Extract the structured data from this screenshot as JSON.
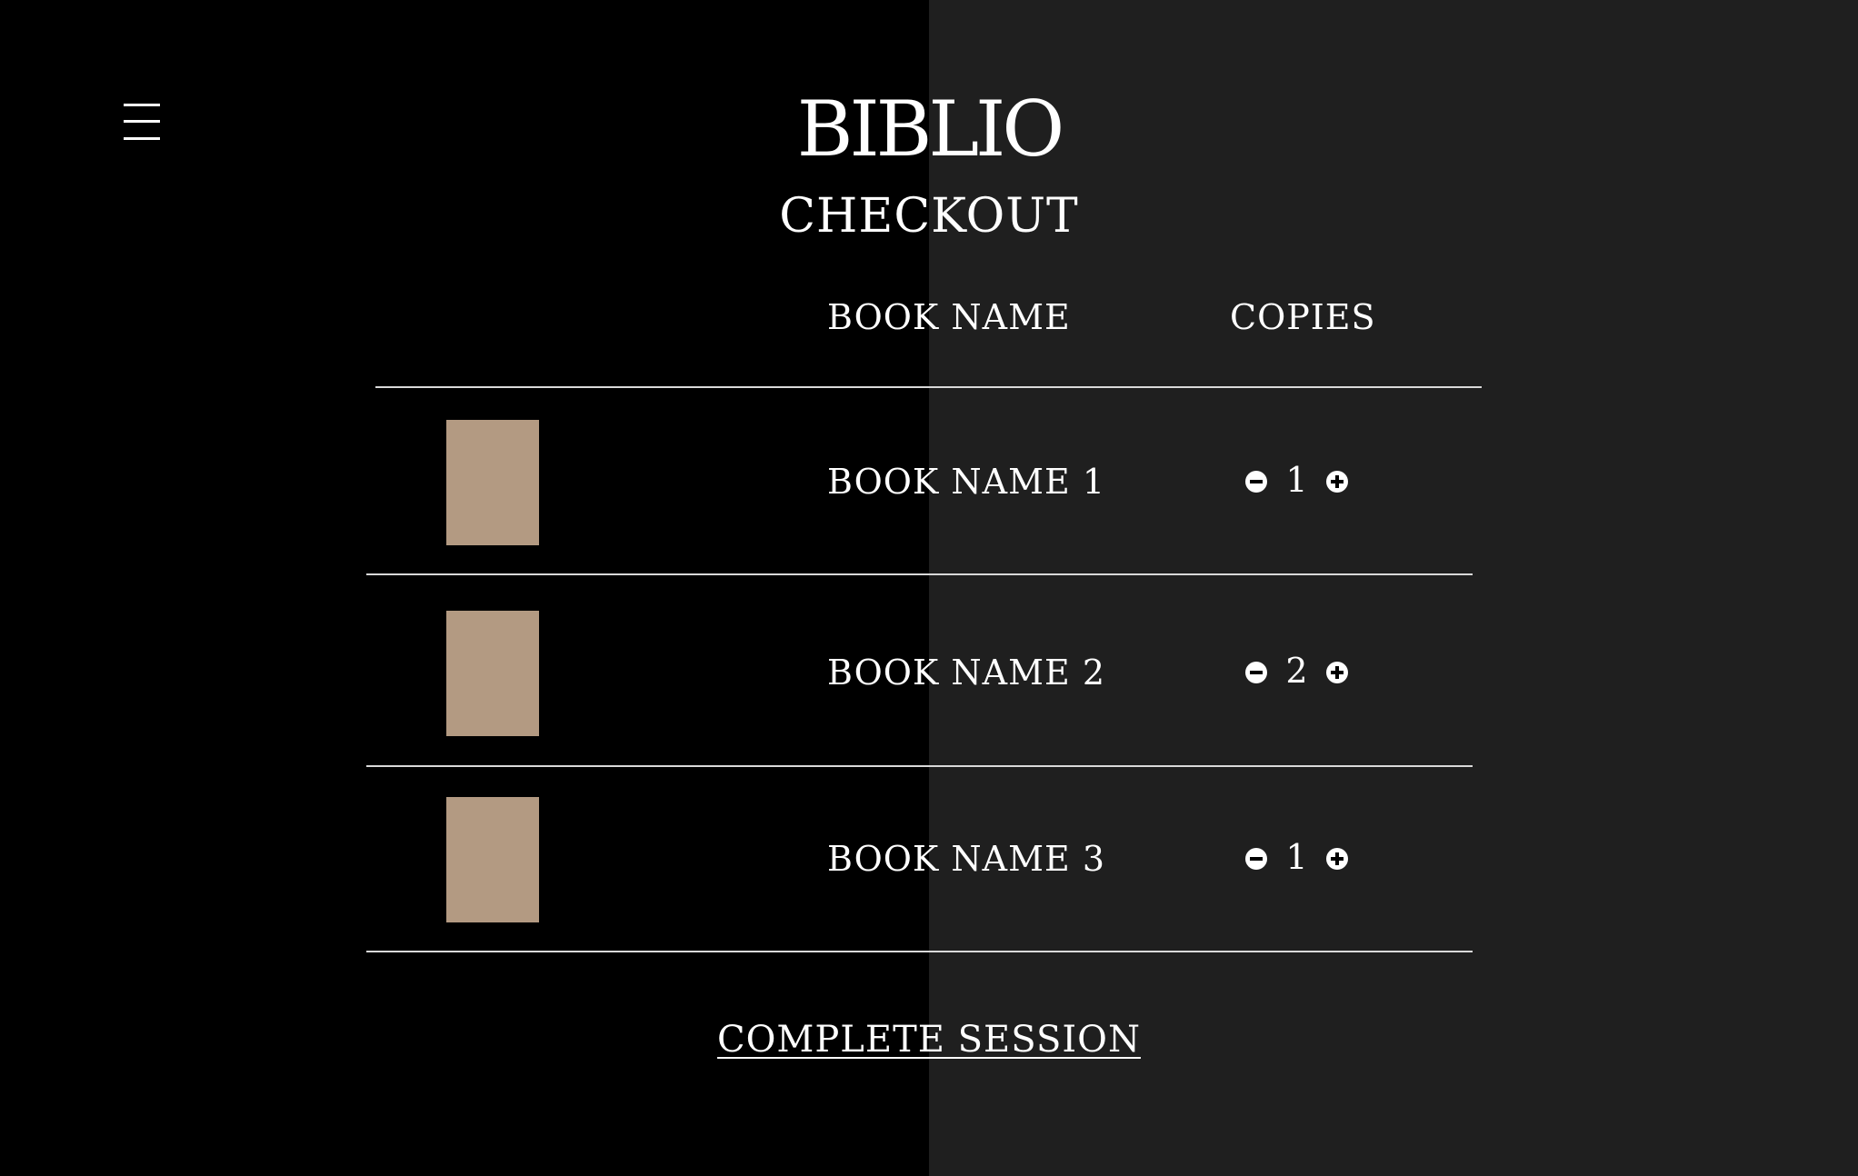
{
  "app": {
    "logo": "BIBLIO",
    "page_title": "CHECKOUT"
  },
  "nav": {
    "menu_icon": "hamburger-menu-icon"
  },
  "table": {
    "headers": {
      "book_name": "BOOK NAME",
      "copies": "COPIES"
    },
    "rows": [
      {
        "name": "BOOK NAME 1",
        "copies": "1"
      },
      {
        "name": "BOOK NAME 2",
        "copies": "2"
      },
      {
        "name": "BOOK NAME 3",
        "copies": "1"
      }
    ]
  },
  "icons": {
    "decrement": "minus-circle-icon",
    "increment": "plus-circle-icon"
  },
  "actions": {
    "complete_label": "COMPLETE SESSION"
  },
  "colors": {
    "background_left": "#000000",
    "background_right": "#1f1f1f",
    "text": "#ffffff",
    "book_cover": "#b39a82",
    "divider": "#d9d9d9"
  }
}
